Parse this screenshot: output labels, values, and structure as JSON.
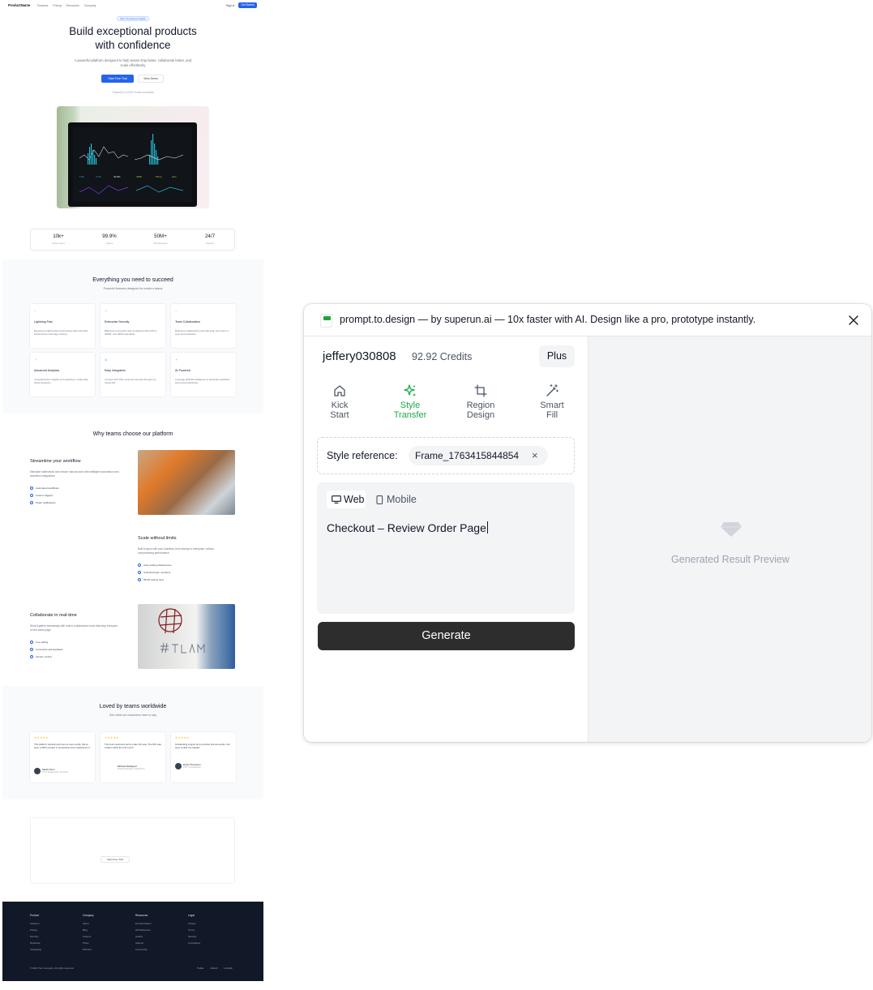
{
  "site": {
    "nav": {
      "logo": "ProductName",
      "links": [
        "Features",
        "Pricing",
        "Resources",
        "Company"
      ],
      "signin": "Sign in",
      "cta": "Get Started"
    },
    "hero": {
      "badge": "New: AI-powered insights",
      "title_line1": "Build exceptional products",
      "title_line2": "with confidence",
      "subtitle": "A powerful platform designed to help teams ship faster, collaborate better, and scale effortlessly",
      "primary": "Start Free Trial",
      "secondary": "View Demo",
      "trusted": "Trusted by 10,000+ teams worldwide"
    },
    "stats": [
      {
        "value": "10k+",
        "label": "Active Users"
      },
      {
        "value": "99.9%",
        "label": "Uptime"
      },
      {
        "value": "50M+",
        "label": "API Requests"
      },
      {
        "value": "24/7",
        "label": "Support"
      }
    ],
    "features": {
      "title": "Everything you need to succeed",
      "subtitle": "Powerful features designed for modern teams",
      "cards": [
        {
          "title": "Lightning Fast",
          "desc": "Experience blazing fast performance with optimized infrastructure and edge caching"
        },
        {
          "title": "Enterprise Security",
          "desc": "Bank-level encryption and compliance with SOC 2, GDPR, and HIPAA standards"
        },
        {
          "title": "Team Collaboration",
          "desc": "Real-time collaboration tools that keep your team in sync and productive"
        },
        {
          "title": "Advanced Analytics",
          "desc": "Comprehensive insights and reporting to make data-driven decisions"
        },
        {
          "title": "Easy Integration",
          "desc": "Connect with 100+ tools and services through our robust API"
        },
        {
          "title": "AI-Powered",
          "desc": "Leverage artificial intelligence to automate workflows and boost productivity"
        }
      ]
    },
    "why": {
      "title": "Why teams choose our platform",
      "rows": [
        {
          "title": "Streamline your workflow",
          "desc": "Eliminate bottlenecks and reduce manual work with intelligent automation and seamless integrations",
          "bullets": [
            "Automated workflows",
            "Custom triggers",
            "Smart notifications"
          ]
        },
        {
          "title": "Scale without limits",
          "desc": "Built to grow with your business, from startup to enterprise, without compromising performance",
          "bullets": [
            "Auto-scaling infrastructure",
            "Unlimited team members",
            "99.9% uptime SLA"
          ]
        },
        {
          "title": "Collaborate in real-time",
          "desc": "Work together seamlessly with built-in collaboration tools that keep everyone on the same page",
          "bullets": [
            "Live editing",
            "Comments and feedback",
            "Version control"
          ]
        }
      ]
    },
    "testimonials": {
      "title": "Loved by teams worldwide",
      "subtitle": "See what our customers have to say",
      "items": [
        {
          "quote": "This platform transformed how our team works. We've seen a 40% increase in productivity since switching to it.",
          "name": "Sarah Chen",
          "role": "VP of Engineering, TechCorp"
        },
        {
          "quote": "The best investment we've made this year. The ROI was evident within the first month.",
          "name": "Michael Rodriguez",
          "role": "Product Manager, StartupXYZ"
        },
        {
          "quote": "Outstanding support and a product that just works. Our team couldn't be happier.",
          "name": "Emily Thompson",
          "role": "CTO, InnovateLabs"
        }
      ]
    },
    "cta": {
      "button": "Start Free Trial"
    },
    "footer": {
      "columns": [
        {
          "heading": "Product",
          "items": [
            "Features",
            "Pricing",
            "Security",
            "Roadmap",
            "Changelog"
          ]
        },
        {
          "heading": "Company",
          "items": [
            "About",
            "Blog",
            "Careers",
            "Press",
            "Partners"
          ]
        },
        {
          "heading": "Resources",
          "items": [
            "Documentation",
            "API Reference",
            "Guides",
            "Support",
            "Community"
          ]
        },
        {
          "heading": "Legal",
          "items": [
            "Privacy",
            "Terms",
            "Security",
            "Compliance"
          ]
        }
      ],
      "copyright": "© 2024 Your Company. All rights reserved.",
      "social": [
        "Twitter",
        "GitHub",
        "LinkedIn"
      ]
    }
  },
  "panel": {
    "title": "prompt.to.design — by superun.ai — 10x faster with AI. Design like a pro, prototype instantly.",
    "username": "jeffery030808",
    "credits": "92.92 Credits",
    "plan": "Plus",
    "modes": [
      {
        "line1": "Kick",
        "line2": "Start",
        "icon": "home-icon",
        "active": false
      },
      {
        "line1": "Style",
        "line2": "Transfer",
        "icon": "sparkle-icon",
        "active": true
      },
      {
        "line1": "Region",
        "line2": "Design",
        "icon": "crop-icon",
        "active": false
      },
      {
        "line1": "Smart",
        "line2": "Fill",
        "icon": "magic-wand-icon",
        "active": false
      }
    ],
    "style_reference": {
      "label": "Style reference:",
      "file": "Frame_1763415844854",
      "remove": "×"
    },
    "platform": {
      "web": "Web",
      "mobile": "Mobile",
      "selected": "Web"
    },
    "prompt": "Checkout – Review Order Page",
    "generate": "Generate",
    "preview_label": "Generated Result Preview",
    "accent_color": "#1fa844"
  }
}
